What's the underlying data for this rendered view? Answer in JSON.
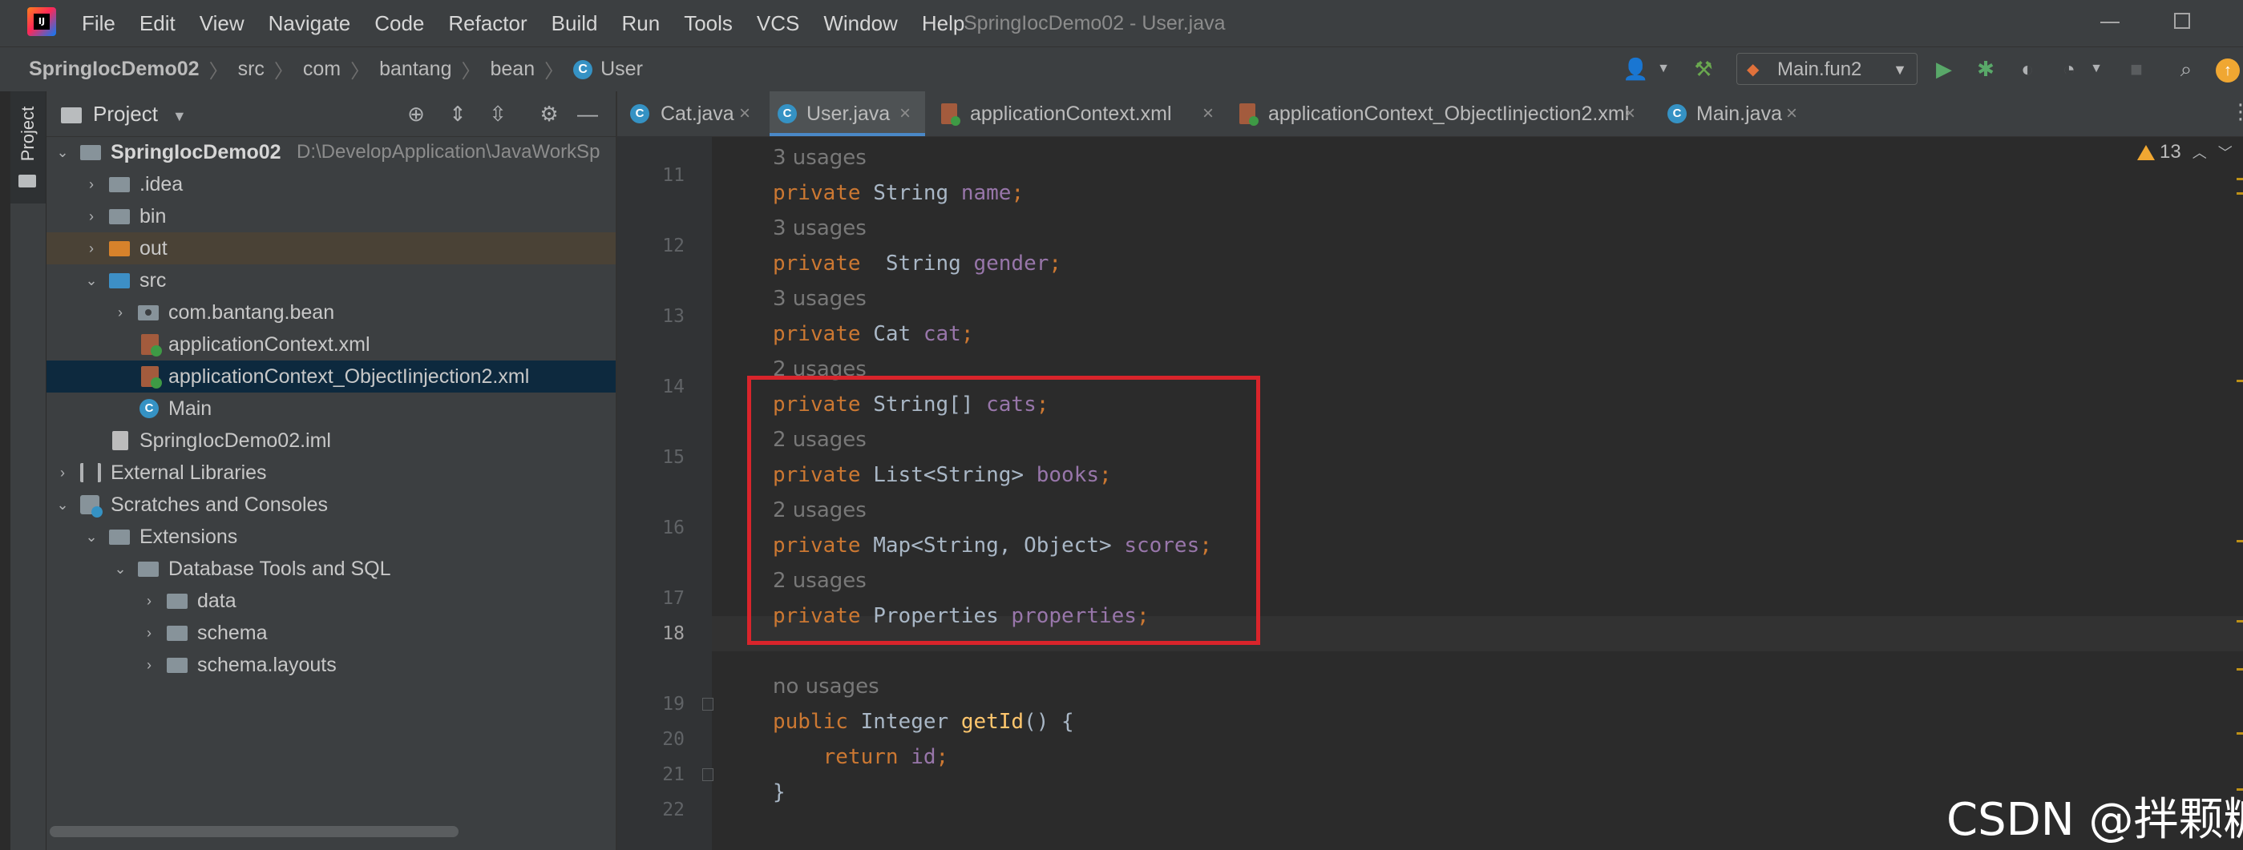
{
  "menubar": {
    "logo": "intellij-idea-icon",
    "items": [
      "File",
      "Edit",
      "View",
      "Navigate",
      "Code",
      "Refactor",
      "Build",
      "Run",
      "Tools",
      "VCS",
      "Window",
      "Help"
    ],
    "window_title": "SpringIocDemo02 - User.java"
  },
  "breadcrumb": {
    "project": "SpringIocDemo02",
    "parts": [
      "src",
      "com",
      "bantang",
      "bean"
    ],
    "class_icon": "C",
    "current": "User"
  },
  "toolbar": {
    "run_config": "Main.fun2",
    "icons": [
      "user-icon",
      "build-hammer-icon",
      "run-icon",
      "debug-icon",
      "coverage-icon",
      "profile-icon",
      "stop-icon",
      "search-icon",
      "update-icon"
    ]
  },
  "stripe": {
    "label": "Project"
  },
  "project_panel": {
    "title": "Project",
    "tree": [
      {
        "label": "SpringIocDemo02",
        "path": "D:\\DevelopApplication\\JavaWorkSp",
        "icon": "module-folder"
      },
      {
        "label": ".idea",
        "icon": "folder"
      },
      {
        "label": "bin",
        "icon": "folder"
      },
      {
        "label": "out",
        "icon": "folder-excluded"
      },
      {
        "label": "src",
        "icon": "folder-source"
      },
      {
        "label": "com.bantang.bean",
        "icon": "package"
      },
      {
        "label": "applicationContext.xml",
        "icon": "spring-xml"
      },
      {
        "label": "applicationContext_ObjectIinjection2.xml",
        "icon": "spring-xml"
      },
      {
        "label": "Main",
        "icon": "java-class"
      },
      {
        "label": "SpringIocDemo02.iml",
        "icon": "iml-file"
      },
      {
        "label": "External Libraries",
        "icon": "library"
      },
      {
        "label": "Scratches and Consoles",
        "icon": "scratches"
      },
      {
        "label": "Extensions",
        "icon": "folder"
      },
      {
        "label": "Database Tools and SQL",
        "icon": "folder"
      },
      {
        "label": "data",
        "icon": "folder"
      },
      {
        "label": "schema",
        "icon": "folder"
      },
      {
        "label": "schema.layouts",
        "icon": "folder"
      }
    ]
  },
  "editor": {
    "tabs": [
      {
        "label": "Cat.java",
        "icon": "C",
        "active": false
      },
      {
        "label": "User.java",
        "icon": "C",
        "active": true
      },
      {
        "label": "applicationContext.xml",
        "icon": "xml",
        "active": false
      },
      {
        "label": "applicationContext_ObjectIinjection2.xml",
        "icon": "xml",
        "active": false
      },
      {
        "label": "Main.java",
        "icon": "C",
        "active": false
      }
    ],
    "inspections": {
      "warnings": "13"
    },
    "lines": {
      "hint_top": "3 usages",
      "l11_kw": "private",
      "l11_type": " String ",
      "l11_field": "name",
      "l11_end": ";",
      "hint_12": "3 usages",
      "l12_kw": "private",
      "l12_type": "  String ",
      "l12_field": "gender",
      "l12_end": ";",
      "hint_13": "3 usages",
      "l13_kw": "private",
      "l13_type": " Cat ",
      "l13_field": "cat",
      "l13_end": ";",
      "hint_14": "2 usages",
      "l14_kw": "private",
      "l14_type": " String[] ",
      "l14_field": "cats",
      "l14_end": ";",
      "hint_15": "2 usages",
      "l15_kw": "private",
      "l15_type": " List<String> ",
      "l15_field": "books",
      "l15_end": ";",
      "hint_16": "2 usages",
      "l16_kw": "private",
      "l16_type": " Map<String, Object> ",
      "l16_field": "scores",
      "l16_end": ";",
      "hint_17": "2 usages",
      "l17_kw": "private",
      "l17_type": " Properties ",
      "l17_field": "properties",
      "l17_end": ";",
      "hint_19": "no usages",
      "l19_kw": "public",
      "l19_type": " Integer ",
      "l19_method": "getId",
      "l19_end": "() {",
      "l20_kw": "return",
      "l20_field": "id",
      "l20_end": ";",
      "l21": "}"
    },
    "line_numbers": [
      "11",
      "12",
      "13",
      "14",
      "15",
      "16",
      "17",
      "18",
      "19",
      "20",
      "21",
      "22"
    ]
  },
  "watermark": "CSDN @拌颗糖",
  "colors": {
    "keyword": "#cc7832",
    "field": "#9876aa",
    "method": "#ffc66d",
    "text": "#a9b7c6",
    "highlight_box": "#d9242b",
    "selection": "#0d293e"
  }
}
